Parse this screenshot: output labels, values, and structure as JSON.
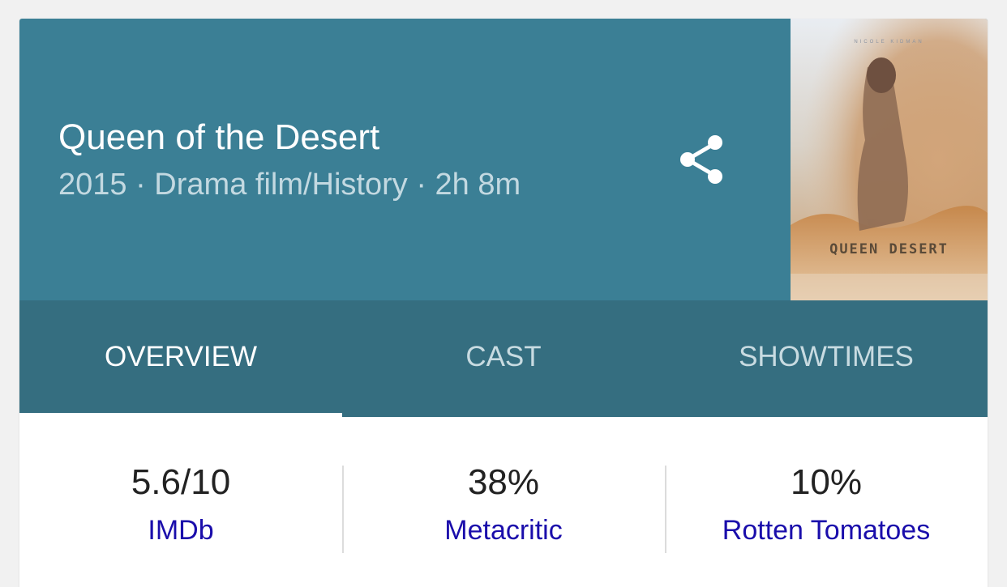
{
  "movie": {
    "title": "Queen of the Desert",
    "subtitle": "2015 · Drama film/History · 2h 8m"
  },
  "poster": {
    "credit_text": "NICOLE KIDMAN",
    "title_text": "QUEEN  DESERT"
  },
  "header": {
    "share_icon": "share-icon",
    "background_color": "#3b7f95"
  },
  "tabs": [
    {
      "label": "OVERVIEW",
      "active": true
    },
    {
      "label": "CAST",
      "active": false
    },
    {
      "label": "SHOWTIMES",
      "active": false
    }
  ],
  "ratings": [
    {
      "value": "5.6/10",
      "source": "IMDb"
    },
    {
      "value": "38%",
      "source": "Metacritic"
    },
    {
      "value": "10%",
      "source": "Rotten Tomatoes"
    }
  ],
  "colors": {
    "tab_bar": "#356e80",
    "link": "#1a0dab"
  }
}
